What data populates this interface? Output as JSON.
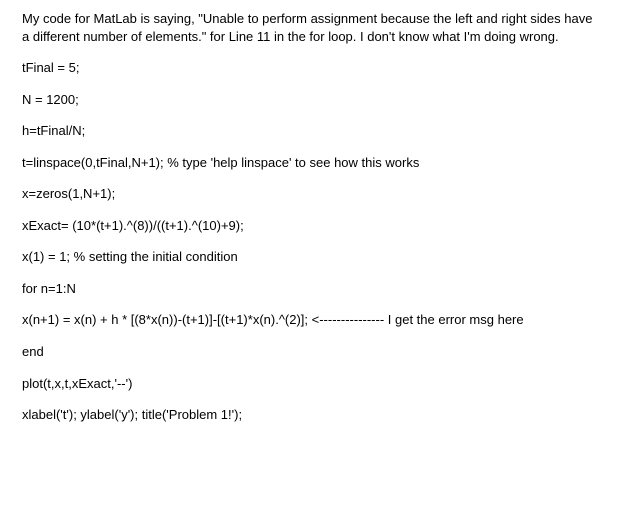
{
  "question": {
    "intro": "My code for MatLab is saying, \"Unable to perform assignment because the left and right sides have a different number of elements.\" for Line 11 in the for loop. I don't know what I'm doing wrong."
  },
  "code": {
    "lines": [
      "tFinal = 5;",
      "N = 1200;",
      "h=tFinal/N;",
      "t=linspace(0,tFinal,N+1); % type 'help linspace' to see how this works",
      "x=zeros(1,N+1);",
      "xExact= (10*(t+1).^(8))/((t+1).^(10)+9);",
      "x(1) = 1; % setting the initial condition",
      "for n=1:N",
      "x(n+1) = x(n) + h * [(8*x(n))-(t+1)]-[(t+1)*x(n).^(2)]; <--------------- I get the error msg here",
      "end",
      "plot(t,x,t,xExact,'--')",
      "xlabel('t'); ylabel('y'); title('Problem 1!');"
    ]
  }
}
